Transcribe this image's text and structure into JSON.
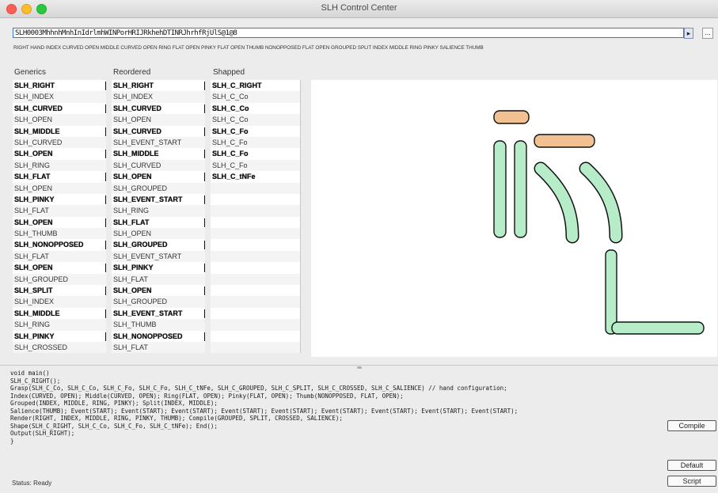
{
  "window": {
    "title": "SLH Control Center"
  },
  "input": {
    "value": "SLH0003MhhnhMnhInIdrlmhWINPorHRIJRkhehDTINRJhrhfRjUlS@1@8",
    "go_label": "▸",
    "dots_label": "..."
  },
  "description": "RIGHT HAND INDEX CURVED OPEN MIDDLE CURVED OPEN RING FLAT OPEN PINKY FLAT OPEN THUMB NONOPPOSED FLAT OPEN GROUPED SPLIT INDEX MIDDLE RING PINKY SALIENCE THUMB",
  "columns": {
    "generics": "Generics",
    "reordered": "Reordered",
    "shapped": "Shapped"
  },
  "generics": [
    "SLH_RIGHT",
    "SLH_INDEX",
    "SLH_CURVED",
    "SLH_OPEN",
    "SLH_MIDDLE",
    "SLH_CURVED",
    "SLH_OPEN",
    "SLH_RING",
    "SLH_FLAT",
    "SLH_OPEN",
    "SLH_PINKY",
    "SLH_FLAT",
    "SLH_OPEN",
    "SLH_THUMB",
    "SLH_NONOPPOSED",
    "SLH_FLAT",
    "SLH_OPEN",
    "SLH_GROUPED",
    "SLH_SPLIT",
    "SLH_INDEX",
    "SLH_MIDDLE",
    "SLH_RING",
    "SLH_PINKY",
    "SLH_CROSSED"
  ],
  "reordered": [
    "SLH_RIGHT",
    "SLH_INDEX",
    "SLH_CURVED",
    "SLH_OPEN",
    "SLH_CURVED",
    "SLH_EVENT_START",
    "SLH_MIDDLE",
    "SLH_CURVED",
    "SLH_OPEN",
    "SLH_GROUPED",
    "SLH_EVENT_START",
    "SLH_RING",
    "SLH_FLAT",
    "SLH_OPEN",
    "SLH_GROUPED",
    "SLH_EVENT_START",
    "SLH_PINKY",
    "SLH_FLAT",
    "SLH_OPEN",
    "SLH_GROUPED",
    "SLH_EVENT_START",
    "SLH_THUMB",
    "SLH_NONOPPOSED",
    "SLH_FLAT"
  ],
  "shapped": [
    "SLH_C_RIGHT",
    "SLH_C_Co",
    "SLH_C_Co",
    "SLH_C_Co",
    "SLH_C_Fo",
    "SLH_C_Fo",
    "SLH_C_Fo",
    "SLH_C_Fo",
    "SLH_C_tNFe",
    "",
    "",
    "",
    "",
    "",
    "",
    "",
    "",
    "",
    "",
    "",
    "",
    "",
    "",
    ""
  ],
  "output_lines": [
    "void main()",
    "    SLH_C_RIGHT();",
    "        Grasp(SLH_C_Co, SLH_C_Co, SLH_C_Fo, SLH_C_Fo, SLH_C_tNFe, SLH_C_GROUPED, SLH_C_SPLIT, SLH_C_CROSSED, SLH_C_SALIENCE) // hand configuration;",
    "    Index(CURVED, OPEN); Middle(CURVED, OPEN); Ring(FLAT, OPEN); Pinky(FLAT, OPEN); Thumb(NONOPPOSED, FLAT, OPEN);",
    "    Grouped(INDEX, MIDDLE, RING, PINKY); Split(INDEX, MIDDLE);",
    "    Salience(THUMB); Event(START); Event(START); Event(START); Event(START); Event(START); Event(START); Event(START); Event(START); Event(START);",
    "    Render(RIGHT, INDEX, MIDDLE, RING, PINKY, THUMB); Compile(GROUPED, SPLIT, CROSSED, SALIENCE);",
    "        Shape(SLH_C_RIGHT, SLH_C_Co, SLH_C_Fo, SLH_C_tNFe); End();",
    "    Output(SLH_RIGHT);",
    "}",
    ""
  ],
  "buttons": {
    "compile": "Compile",
    "default": "Default",
    "script": "Script"
  },
  "status": "Status: Ready"
}
